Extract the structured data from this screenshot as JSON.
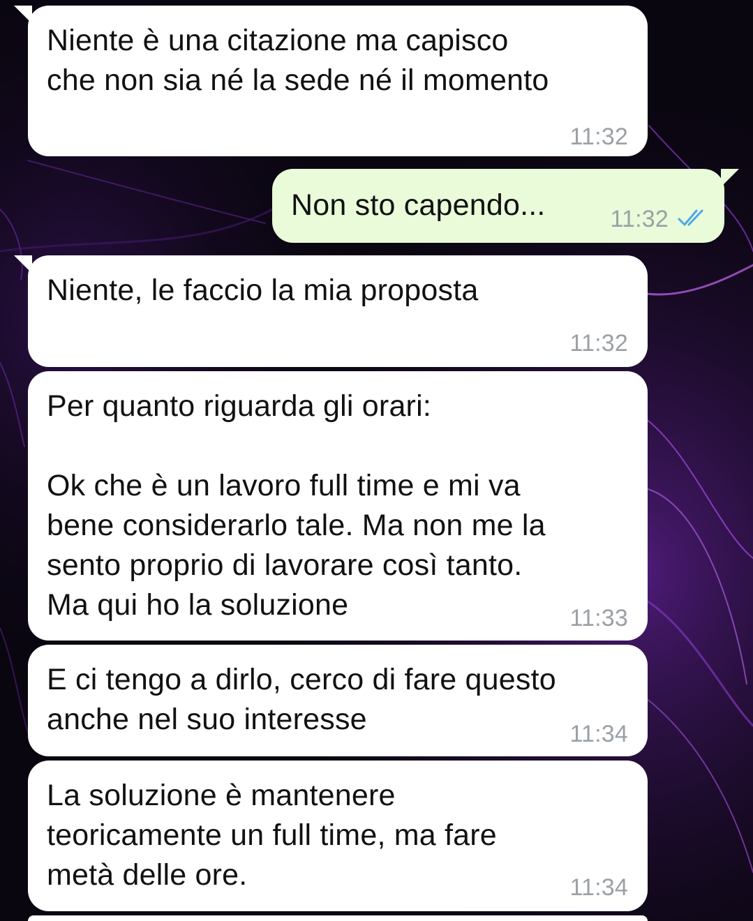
{
  "messages": [
    {
      "direction": "incoming",
      "text": "Niente è una citazione ma capisco\nche non sia né la sede né il momento",
      "time": "11:32"
    },
    {
      "direction": "outgoing",
      "text": "Non sto capendo...",
      "time": "11:32",
      "status": "read-double-check-icon"
    },
    {
      "direction": "incoming",
      "text": "Niente, le faccio la mia proposta",
      "time": "11:32"
    },
    {
      "direction": "incoming",
      "text": "Per quanto riguarda gli orari:\n\nOk che è un lavoro full time e mi va\nbene considerarlo tale. Ma non me la\nsento proprio di lavorare così tanto.\nMa qui ho la soluzione",
      "time": "11:33"
    },
    {
      "direction": "incoming",
      "text": "E ci tengo a dirlo, cerco di fare questo\nanche nel suo interesse",
      "time": "11:34"
    },
    {
      "direction": "incoming",
      "text": "La soluzione è mantenere\nteoricamente un full time, ma fare\nmetà delle ore.",
      "time": "11:34"
    }
  ],
  "colors": {
    "incoming_bubble": "#ffffff",
    "outgoing_bubble": "#e9fbd9",
    "read_ticks": "#4fa6e8",
    "timestamp": "#9aa0a6",
    "wallpaper_base": "#0a0610",
    "wallpaper_accent": "#7a2bb5"
  }
}
